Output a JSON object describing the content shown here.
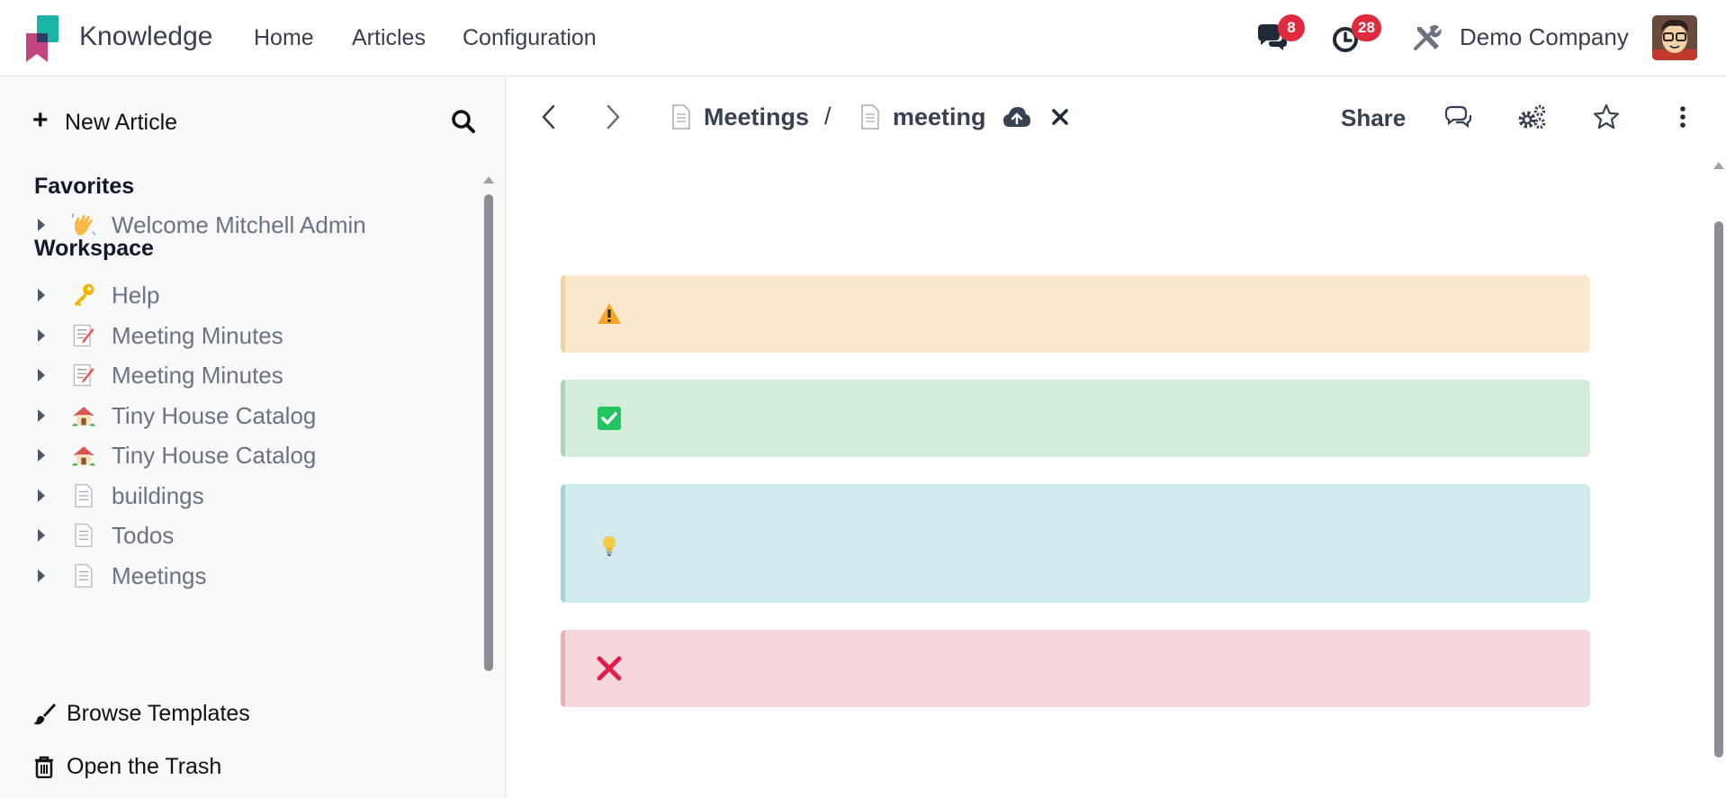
{
  "navbar": {
    "app_name": "Knowledge",
    "menu": [
      "Home",
      "Articles",
      "Configuration"
    ],
    "messages_badge": "8",
    "activities_badge": "28",
    "company": "Demo Company",
    "accent_color": "#e02a3d"
  },
  "sidebar": {
    "new_article_label": "New Article",
    "favorites_title": "Favorites",
    "favorites": [
      {
        "emoji": "waving-hand",
        "label": "Welcome Mitchell Admin"
      }
    ],
    "workspace_title": "Workspace",
    "workspace": [
      {
        "emoji": "key",
        "label": "Help"
      },
      {
        "emoji": "memo",
        "label": "Meeting Minutes"
      },
      {
        "emoji": "memo",
        "label": "Meeting Minutes"
      },
      {
        "emoji": "house",
        "label": "Tiny House Catalog"
      },
      {
        "emoji": "house",
        "label": "Tiny House Catalog"
      },
      {
        "emoji": "document",
        "label": "buildings"
      },
      {
        "emoji": "document",
        "label": "Todos"
      },
      {
        "emoji": "document",
        "label": "Meetings"
      }
    ],
    "browse_templates_label": "Browse Templates",
    "open_trash_label": "Open the Trash"
  },
  "main": {
    "breadcrumb": [
      {
        "icon": "document-icon",
        "label": "Meetings"
      },
      {
        "icon": "document-icon",
        "label": "meeting"
      }
    ],
    "breadcrumb_separator": "/",
    "share_label": "Share",
    "callouts": [
      {
        "type": "warning",
        "icon": "warning-icon",
        "color": "#fbe9cd"
      },
      {
        "type": "success",
        "icon": "checkbox-icon",
        "color": "#d4eddb"
      },
      {
        "type": "info",
        "icon": "lightbulb-icon",
        "color": "#d2ebef"
      },
      {
        "type": "danger",
        "icon": "cross-mark-icon",
        "color": "#f6d7dc"
      }
    ]
  }
}
